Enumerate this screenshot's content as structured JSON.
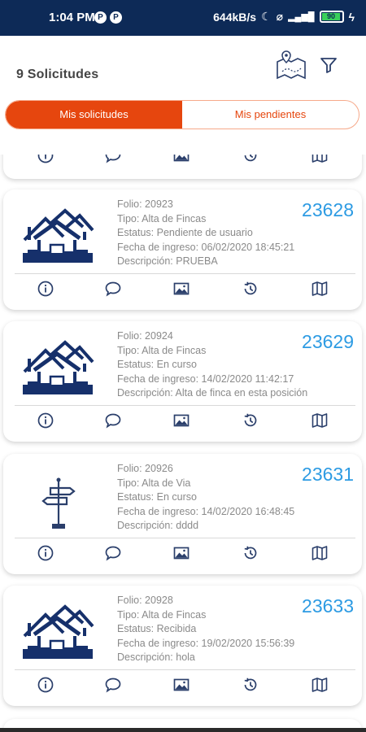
{
  "status_bar": {
    "time": "1:04 PM",
    "left_icons": [
      "P",
      "P"
    ],
    "network_speed": "644kB/s",
    "battery": "90"
  },
  "header": {
    "title": "9 Solicitudes",
    "map_icon": "map-icon",
    "filter_icon": "filter-icon"
  },
  "segments": {
    "mine": "Mis solicitudes",
    "pending": "Mis pendientes",
    "active_color": "#e6460e"
  },
  "actions": [
    "info-icon",
    "comment-icon",
    "image-icon",
    "history-icon",
    "map-icon"
  ],
  "cards": [
    {
      "type": "fincas",
      "folio": "Folio: 20923",
      "tipo": "Tipo: Alta de Fincas",
      "estatus": "Estatus: Pendiente de usuario",
      "fecha": "Fecha de ingreso: 06/02/2020 18:45:21",
      "descripcion": "Descripción: PRUEBA",
      "numero": "23628"
    },
    {
      "type": "fincas",
      "folio": "Folio: 20924",
      "tipo": "Tipo: Alta de Fincas",
      "estatus": "Estatus: En curso",
      "fecha": "Fecha de ingreso: 14/02/2020 11:42:17",
      "descripcion": "Descripción: Alta de finca en esta posición",
      "numero": "23629"
    },
    {
      "type": "via",
      "folio": "Folio: 20926",
      "tipo": "Tipo: Alta de Via",
      "estatus": "Estatus: En curso",
      "fecha": "Fecha de ingreso: 14/02/2020 16:48:45",
      "descripcion": "Descripción: dddd",
      "numero": "23631"
    },
    {
      "type": "fincas",
      "folio": "Folio: 20928",
      "tipo": "Tipo: Alta de Fincas",
      "estatus": "Estatus: Recibida",
      "fecha": "Fecha de ingreso: 19/02/2020 15:56:39",
      "descripcion": "Descripción: hola",
      "numero": "23633"
    }
  ]
}
